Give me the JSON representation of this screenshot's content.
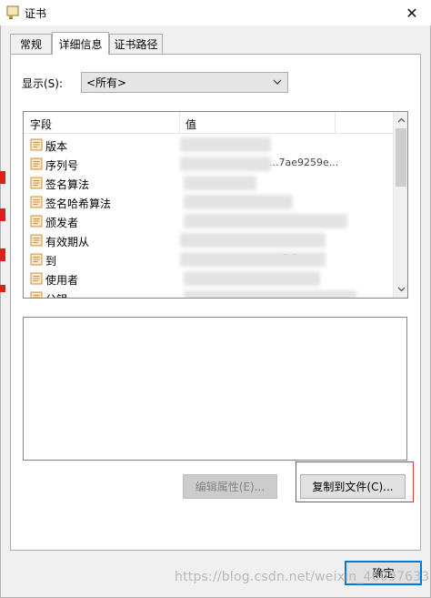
{
  "window": {
    "title": "证书",
    "close_glyph": "✕"
  },
  "tabs": [
    {
      "label": "常规",
      "active": false
    },
    {
      "label": "详细信息",
      "active": true
    },
    {
      "label": "证书路径",
      "active": false
    }
  ],
  "details": {
    "show_label": "显示(S):",
    "show_select_value": "<所有>",
    "columns": [
      "字段",
      "值"
    ],
    "rows": [
      {
        "field": "版本",
        "value": ""
      },
      {
        "field": "序列号",
        "value": "...7ae9259e..."
      },
      {
        "field": "签名算法",
        "value": ""
      },
      {
        "field": "签名哈希算法",
        "value": ""
      },
      {
        "field": "颁发者",
        "value": ""
      },
      {
        "field": "有效期从",
        "value": ""
      },
      {
        "field": "到",
        "value": "...-7 1 ..."
      },
      {
        "field": "使用者",
        "value": ""
      },
      {
        "field": "公钥",
        "value": ""
      }
    ],
    "icons": {
      "row": "certificate-field-icon",
      "scroll_up": "chevron-up-icon",
      "scroll_down": "chevron-down-icon",
      "select": "chevron-down-icon"
    }
  },
  "buttons": {
    "edit_properties": "编辑属性(E)...",
    "copy_to_file": "复制到文件(C)...",
    "ok": "确定"
  },
  "annotation_color": "#e03030",
  "accent": "#0078d7",
  "watermark": "https://blog.csdn.net/weixin_46097633"
}
